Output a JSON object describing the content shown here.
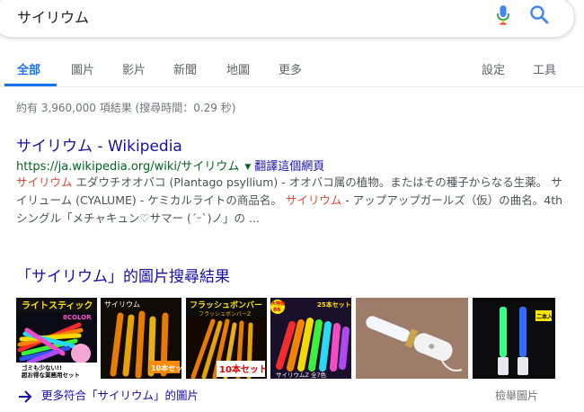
{
  "search": {
    "query": "サイリウム",
    "mic_icon": "microphone-icon",
    "search_icon": "magnifier-icon"
  },
  "tabs": {
    "items": [
      {
        "label": "全部",
        "active": true
      },
      {
        "label": "圖片"
      },
      {
        "label": "影片"
      },
      {
        "label": "新聞"
      },
      {
        "label": "地圖"
      },
      {
        "label": "更多"
      }
    ],
    "settings": "設定",
    "tools": "工具"
  },
  "stats": "約有 3,960,000 項結果 (搜尋時間：0.29 秒)",
  "result": {
    "title": "サイリウム - Wikipedia",
    "url": "https://ja.wikipedia.org/wiki/サイリウム",
    "translate": "翻譯這個網頁",
    "snippet": {
      "s1": "サイリウム",
      "s2": " エダウチオオバコ (Plantago psyllium) - オオバコ属の植物。またはその種子からなる生薬。 サイリューム (CYALUME) - ケミカルライトの商品名。 ",
      "s3": "サイリウム",
      "s4": " - アップアップガールズ（仮）の曲名。4thシングル「メチャキュン♡サマー (´ᵕ`)ノ」の ..."
    }
  },
  "images": {
    "heading": "「サイリウム」的圖片搜尋結果",
    "thumb1": {
      "title": "ライトスティック",
      "sub": "8COLOR",
      "note1": "ゴミも少ない!!",
      "note2": "超お得な業務用セット"
    },
    "thumb2": {
      "title": "サイリウム",
      "badge": "10本セット"
    },
    "thumb3": {
      "title": "フラッシュボンバー",
      "sub": "フラッシュボンバーZ",
      "badge": "10本セット"
    },
    "thumb4": {
      "big": "大特価",
      "num": "86",
      "set": "25本セット",
      "label": "サイリウムZ 全7色"
    },
    "thumb6": {
      "tag": "二本入"
    },
    "more": "更多符合「サイリウム」的圖片",
    "report": "檢舉圖片",
    "colors": {
      "red": "#ff2d2d",
      "orange": "#ff8a00",
      "yellow": "#ffe600",
      "green": "#3cff3c",
      "cyan": "#29e6ff",
      "blue": "#2f5bff",
      "pink": "#ff4fd0",
      "purple": "#b84dff"
    }
  }
}
